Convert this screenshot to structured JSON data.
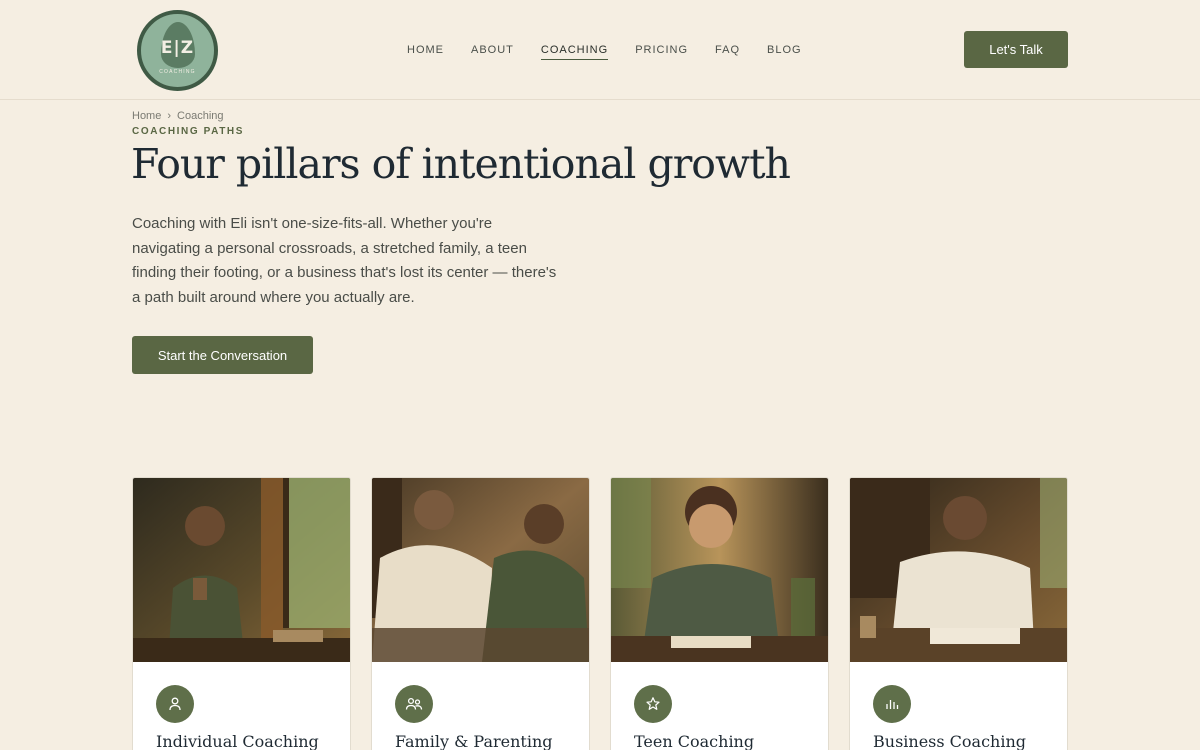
{
  "brand": {
    "initials": "E|Z",
    "subtitle": "COACHING"
  },
  "nav": {
    "items": [
      {
        "label": "HOME"
      },
      {
        "label": "ABOUT"
      },
      {
        "label": "COACHING"
      },
      {
        "label": "PRICING"
      },
      {
        "label": "FAQ"
      },
      {
        "label": "BLOG"
      }
    ],
    "active": "COACHING"
  },
  "header_cta": "Let's Talk",
  "breadcrumb": {
    "home": "Home",
    "separator": "›",
    "current": "Coaching"
  },
  "hero": {
    "eyebrow": "COACHING PATHS",
    "title": "Four pillars of intentional growth",
    "text": "Coaching with Eli isn't one-size-fits-all. Whether you're navigating a personal crossroads, a stretched family, a teen finding their footing, or a business that's lost its center — there's a path built around where you actually are.",
    "cta": "Start the Conversation"
  },
  "cards": [
    {
      "title": "Individual Coaching",
      "icon": "person-icon"
    },
    {
      "title": "Family & Parenting",
      "icon": "people-icon"
    },
    {
      "title": "Teen Coaching",
      "icon": "star-icon"
    },
    {
      "title": "Business Coaching",
      "icon": "bar-chart-icon"
    }
  ],
  "colors": {
    "accent": "#5a6744",
    "background": "#f5eee2",
    "icon_bg": "#5f6f4a"
  }
}
